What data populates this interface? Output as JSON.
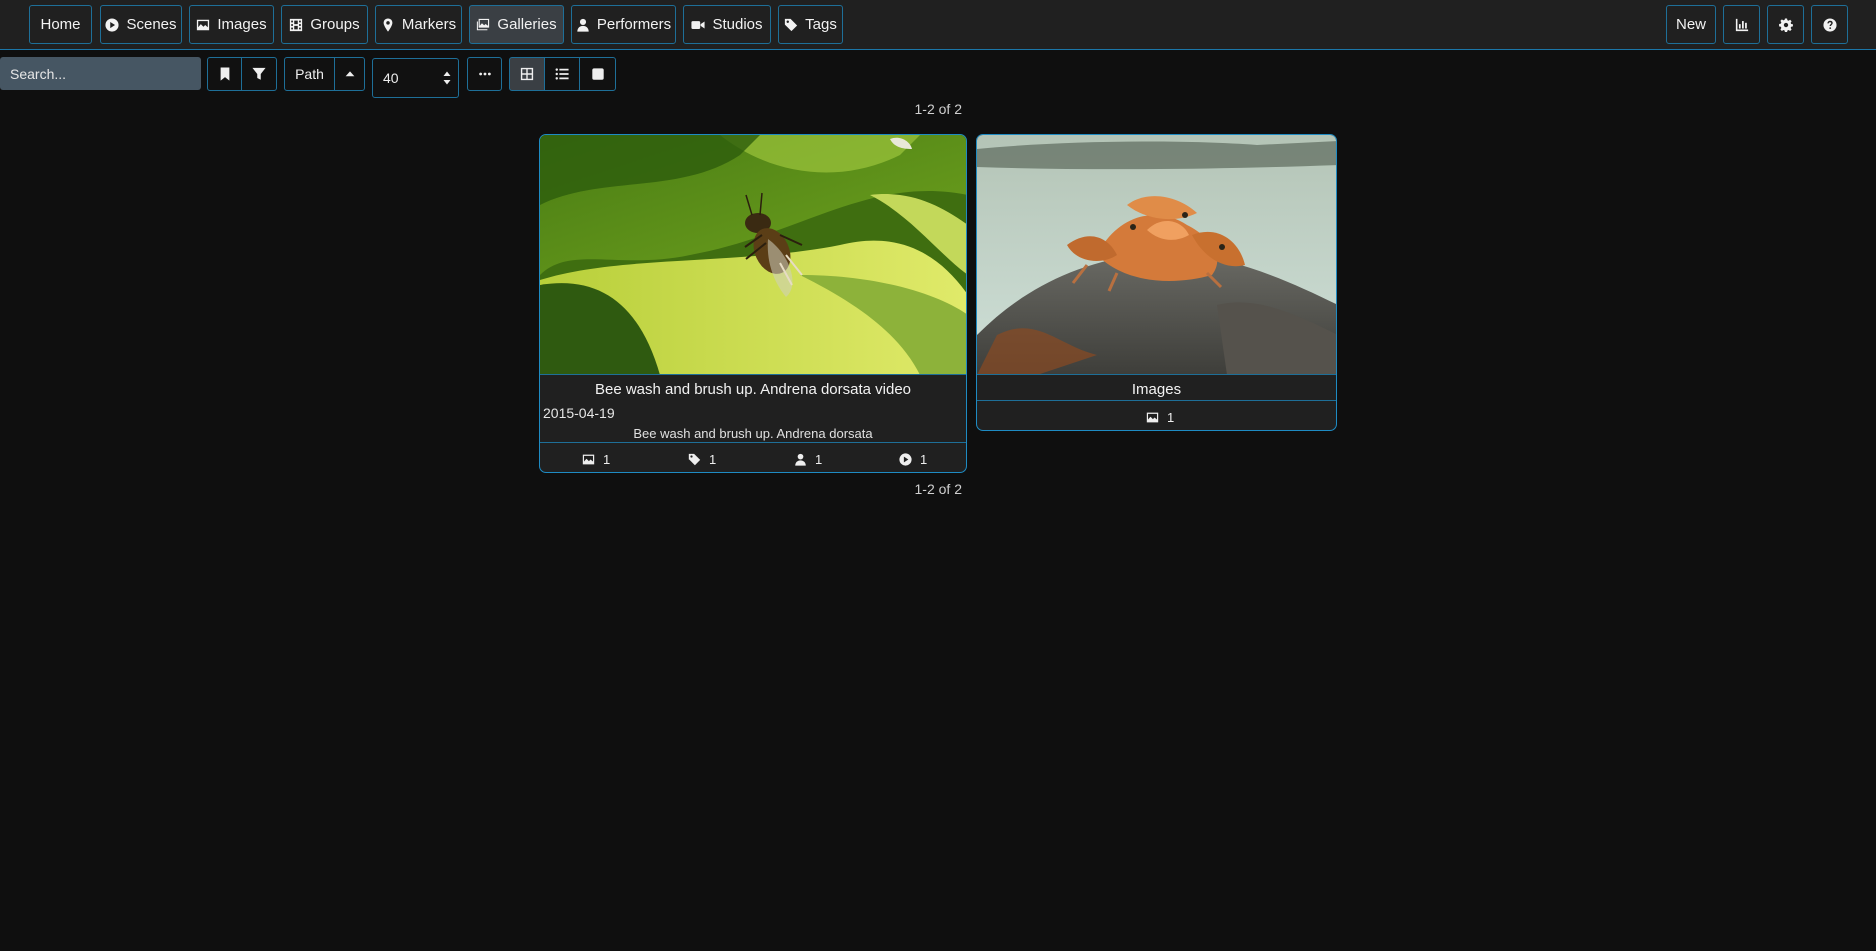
{
  "nav": {
    "items": [
      {
        "label": "Home",
        "icon": ""
      },
      {
        "label": "Scenes",
        "icon": "play-circle-icon"
      },
      {
        "label": "Images",
        "icon": "image-icon"
      },
      {
        "label": "Groups",
        "icon": "film-icon"
      },
      {
        "label": "Markers",
        "icon": "map-marker-icon"
      },
      {
        "label": "Galleries",
        "icon": "images-icon",
        "active": true
      },
      {
        "label": "Performers",
        "icon": "user-icon"
      },
      {
        "label": "Studios",
        "icon": "video-camera-icon"
      },
      {
        "label": "Tags",
        "icon": "tag-icon"
      }
    ],
    "new_label": "New",
    "right_icons": [
      "stats-chart-icon",
      "gear-icon",
      "help-icon"
    ]
  },
  "toolbar": {
    "search_placeholder": "Search...",
    "sort_by": "Path",
    "per_page": "40",
    "display_modes": [
      "grid-icon",
      "list-icon",
      "wall-icon"
    ],
    "active_display_mode": "grid-icon"
  },
  "pagination": {
    "top": "1-2 of 2",
    "bottom": "1-2 of 2"
  },
  "galleries": [
    {
      "title": "Bee wash and brush up. Andrena dorsata video",
      "date": "2015-04-19",
      "description": "Bee wash and brush up. Andrena dorsata",
      "counts": {
        "images": "1",
        "tags": "1",
        "performers": "1",
        "scenes": "1"
      }
    },
    {
      "title": "Images",
      "counts": {
        "images": "1"
      }
    }
  ]
}
